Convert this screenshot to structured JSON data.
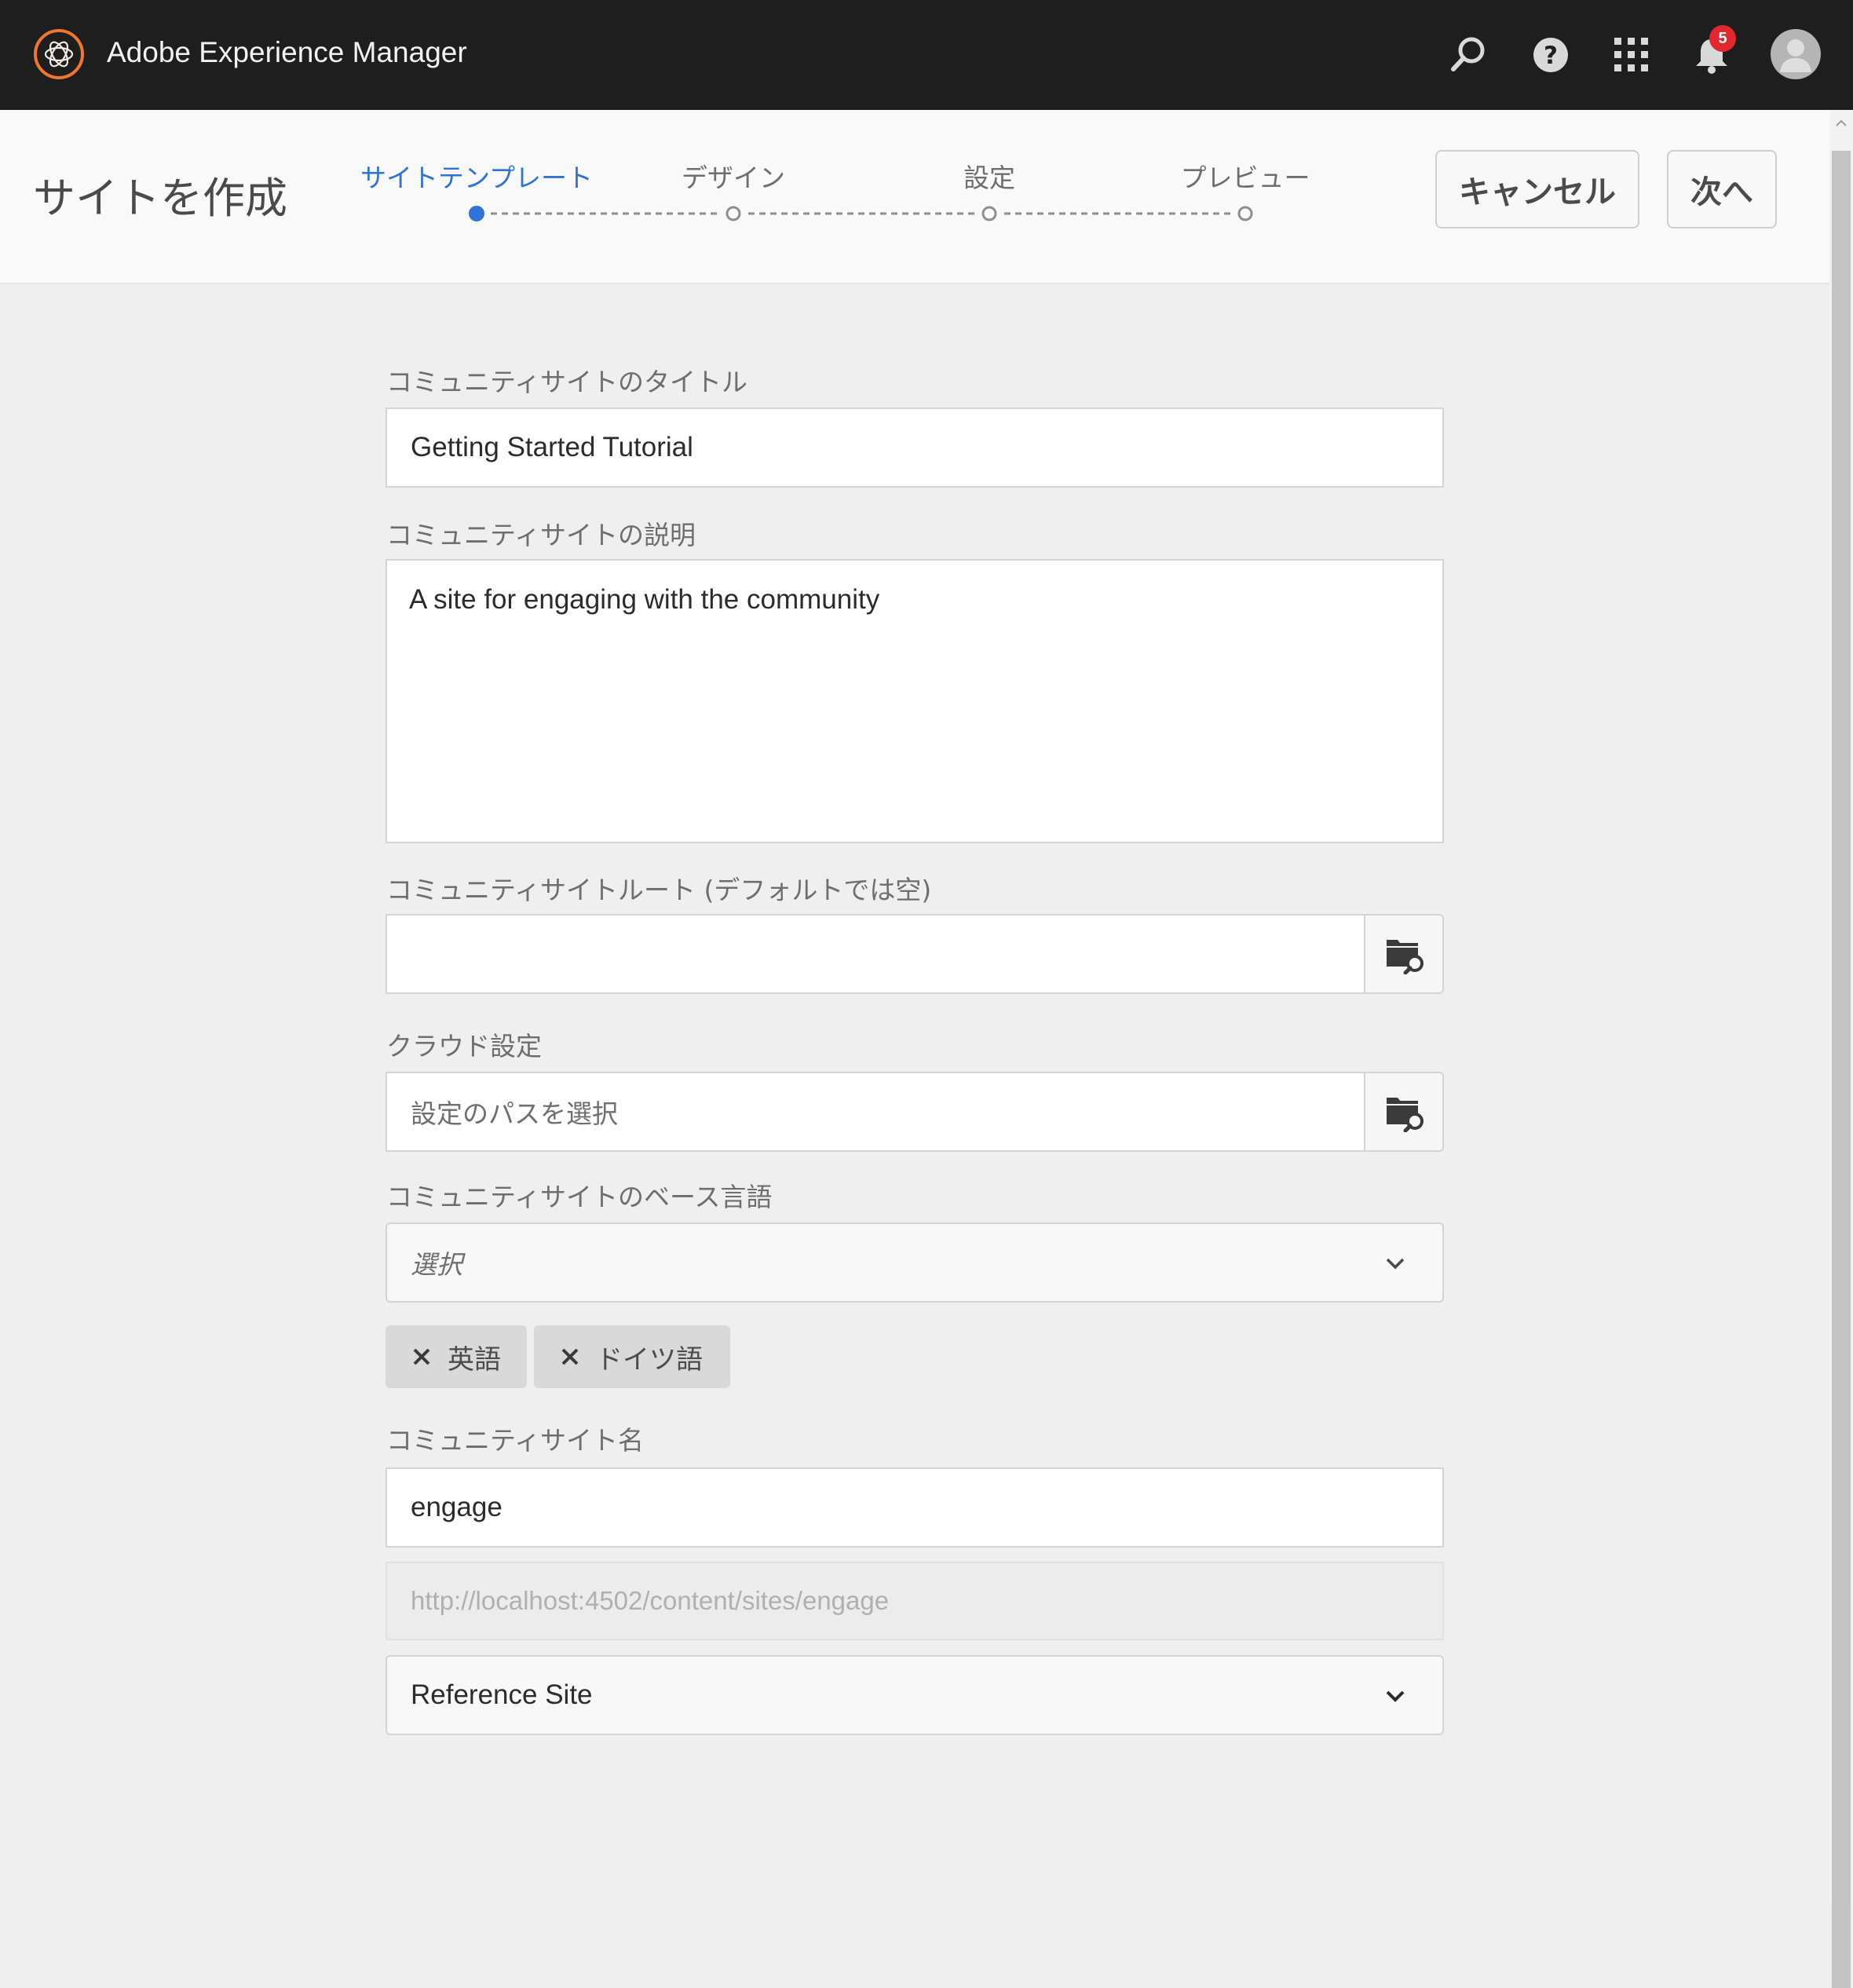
{
  "app": {
    "title": "Adobe Experience Manager"
  },
  "topbar": {
    "icons": [
      "adobe-logo-icon",
      "search-icon",
      "help-icon",
      "apps-grid-icon",
      "bell-icon",
      "avatar-icon"
    ],
    "notification_count": "5",
    "badge_color": "#e0282e"
  },
  "header": {
    "title": "サイトを作成",
    "steps": [
      {
        "label": "サイトテンプレート",
        "active": true
      },
      {
        "label": "デザイン",
        "active": false
      },
      {
        "label": "設定",
        "active": false
      },
      {
        "label": "プレビュー",
        "active": false
      }
    ],
    "cancel_label": "キャンセル",
    "next_label": "次へ",
    "accent_color": "#2d74d6"
  },
  "form": {
    "site_title": {
      "label": "コミュニティサイトのタイトル",
      "value": "Getting Started Tutorial"
    },
    "site_description": {
      "label": "コミュニティサイトの説明",
      "value": "A site for engaging with the community"
    },
    "site_root": {
      "label": "コミュニティサイトルート (デフォルトでは空)",
      "value": ""
    },
    "cloud_config": {
      "label": "クラウド設定",
      "placeholder": "設定のパスを選択"
    },
    "base_language": {
      "label": "コミュニティサイトのベース言語",
      "placeholder": "選択",
      "selected_tags": [
        "英語",
        "ドイツ語"
      ]
    },
    "site_name": {
      "label": "コミュニティサイト名",
      "value": "engage",
      "url_preview": "http://localhost:4502/content/sites/engage"
    },
    "template_select": {
      "value": "Reference Site"
    }
  }
}
